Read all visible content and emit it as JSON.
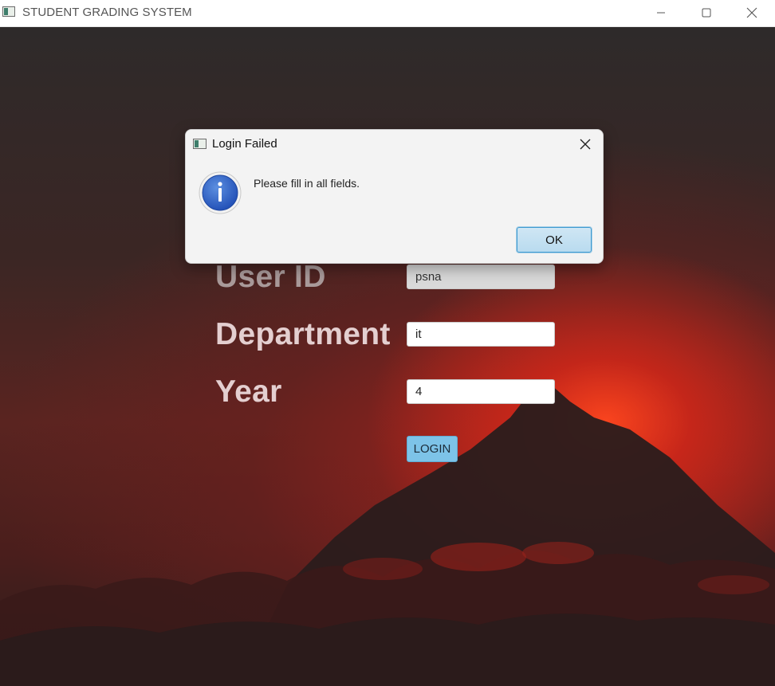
{
  "window": {
    "title": "STUDENT GRADING SYSTEM",
    "icon": "app-window-icon",
    "controls": [
      "minimize-icon",
      "maximize-icon",
      "close-icon"
    ]
  },
  "form": {
    "user_id_label": "User ID",
    "user_id_value": "psna",
    "department_label": "Department",
    "department_value": "it",
    "year_label": "Year",
    "year_value": "4",
    "login_label": "LOGIN"
  },
  "dialog": {
    "title": "Login Failed",
    "message": "Please fill in all fields.",
    "ok_label": "OK",
    "icon": "info-icon"
  },
  "colors": {
    "accent_button": "#7dc3e8",
    "ok_border": "#3d9ad1",
    "label_text": "#e4cfd0"
  }
}
